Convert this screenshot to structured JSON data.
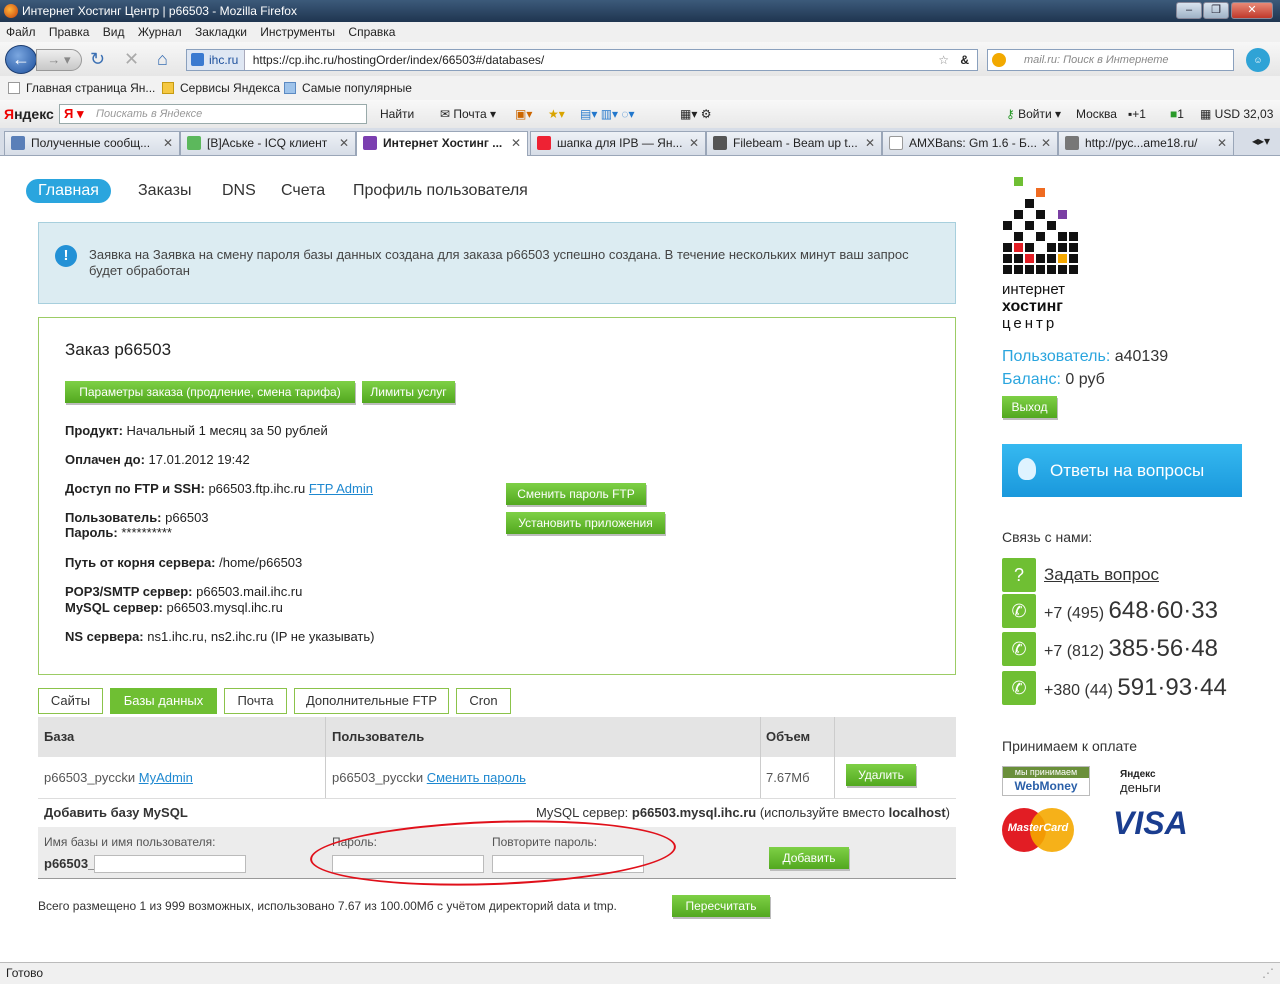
{
  "window": {
    "title": "Интернет Хостинг Центр | p66503 - Mozilla Firefox"
  },
  "menu": [
    "Файл",
    "Правка",
    "Вид",
    "Журнал",
    "Закладки",
    "Инструменты",
    "Справка"
  ],
  "nav": {
    "site": "ihc.ru",
    "url": "https://cp.ihc.ru/hostingOrder/index/66503#/databases/",
    "search_placeholder": "mail.ru: Поиск в Интернете"
  },
  "bookmarks": [
    "Главная страница Ян...",
    "Сервисы Яндекса",
    "Самые популярные"
  ],
  "yandex_bar": {
    "logo_prefix": "Я",
    "logo_rest": "ндекс",
    "search_placeholder": "Поискать в Яндексе",
    "find": "Найти",
    "mail": "Почта",
    "login": "Войти",
    "city": "Москва",
    "temp": "+1",
    "count": "1",
    "usd": "USD 32,03"
  },
  "tabs": [
    {
      "label": "Полученные сообщ..."
    },
    {
      "label": "[B]Аське - ICQ клиент"
    },
    {
      "label": "Интернет Хостинг ..."
    },
    {
      "label": "шапка для IPB — Ян..."
    },
    {
      "label": "Filebeam - Beam up t..."
    },
    {
      "label": "AMXBans: Gm 1.6 - Б..."
    },
    {
      "label": "http://рус...ame18.ru/"
    }
  ],
  "topnav": [
    "Главная",
    "Заказы",
    "DNS",
    "Счета",
    "Профиль пользователя"
  ],
  "alert": "Заявка на Заявка на смену пароля базы данных создана для заказа p66503 успешно создана. В течение нескольких минут ваш запрос будет обработан",
  "order": {
    "title": "Заказ p66503",
    "btn_params": "Параметры заказа (продление, смена тарифа)",
    "btn_limits": "Лимиты услуг",
    "product_k": "Продукт:",
    "product_v": "Начальный 1 месяц за 50 рублей",
    "paid_k": "Оплачен до:",
    "paid_v": "17.01.2012 19:42",
    "ftp_k": "Доступ по FTP и SSH:",
    "ftp_v": "p66503.ftp.ihc.ru",
    "ftp_link": "FTP Admin",
    "user_k": "Пользователь:",
    "user_v": "p66503",
    "pass_k": "Пароль:",
    "pass_v": "**********",
    "path_k": "Путь от корня сервера:",
    "path_v": "/home/p66503",
    "pop_k": "POP3/SMTP сервер:",
    "pop_v": "p66503.mail.ihc.ru",
    "mysql_k": "MySQL сервер:",
    "mysql_v": "p66503.mysql.ihc.ru",
    "ns_k": "NS сервера:",
    "ns_v": "ns1.ihc.ru, ns2.ihc.ru (IP не указывать)",
    "btn_change_ftp": "Сменить пароль FTP",
    "btn_install": "Установить приложения"
  },
  "service_tabs": [
    "Сайты",
    "Базы данных",
    "Почта",
    "Дополнительные FTP",
    "Cron"
  ],
  "db_table": {
    "headers": [
      "База",
      "Пользователь",
      "Объем"
    ],
    "rows": [
      {
        "db": "p66503_pycckи",
        "db_link": "MyAdmin",
        "user": "p66503_pycckи",
        "user_link": "Сменить пароль",
        "size": "7.67Мб",
        "action": "Удалить"
      }
    ],
    "add_title": "Добавить базу MySQL",
    "server_prefix": "MySQL сервер:",
    "server": "p66503.mysql.ihc.ru",
    "server_note": "(используйте вместо",
    "server_local": "localhost",
    "server_close": ")",
    "name_label": "Имя базы и имя пользователя:",
    "name_prefix": "p66503_",
    "pass_label": "Пароль:",
    "repeat_label": "Повторите пароль:",
    "add_button": "Добавить"
  },
  "summary": {
    "text": "Всего размещено 1 из 999 возможных, использовано 7.67 из 100.00Мб с учётом директорий data и tmp.",
    "button": "Пересчитать"
  },
  "sidebar": {
    "logo_l1": "интернет",
    "logo_l2": "хостинг",
    "logo_l3": "центр",
    "user_k": "Пользователь:",
    "user_v": "a40139",
    "balance_k": "Баланс:",
    "balance_v": "0 руб",
    "logout": "Выход",
    "faq": "Ответы на вопросы",
    "contact": "Связь с нами:",
    "ask": "Задать вопрос",
    "phones": [
      {
        "prefix": "+7 (495)",
        "number": "648·60·33"
      },
      {
        "prefix": "+7 (812)",
        "number": "385·56·48"
      },
      {
        "prefix": "+380 (44)",
        "number": "591·93·44"
      }
    ],
    "pay_label": "Принимаем к оплате",
    "pay": {
      "webmoney_top": "мы принимаем",
      "webmoney": "WebMoney",
      "yandex_top": "Яндекс",
      "yandex": "деньги",
      "mastercard": "MasterCard",
      "visa": "VISA"
    }
  },
  "status": "Готово"
}
